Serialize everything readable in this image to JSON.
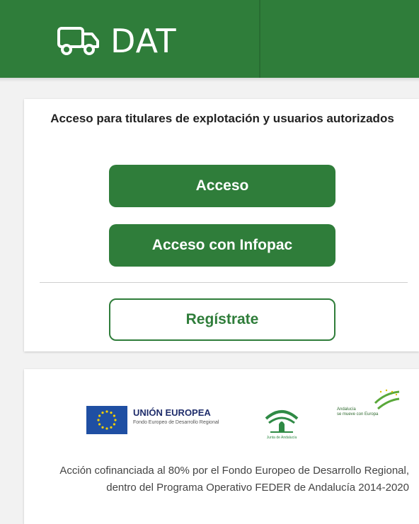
{
  "header": {
    "app_name": "DAT",
    "icon": "truck-icon",
    "color": "#2f7d3a"
  },
  "login": {
    "title": "Acceso para titulares de explotación y usuarios autorizados",
    "access_label": "Acceso",
    "infopac_label": "Acceso con Infopac",
    "register_label": "Regístrate"
  },
  "sponsors": {
    "eu_title": "UNIÓN EUROPEA",
    "eu_subtitle": "Fondo Europeo de Desarrollo Regional",
    "junta_caption": "Junta de Andalucía",
    "andalucia_caption_1": "Andalucía",
    "andalucia_caption_2": "se mueve con Europa",
    "description": "Acción cofinanciada al 80% por el Fondo Europeo de Desarrollo Regional, dentro del Programa Operativo FEDER de Andalucía 2014-2020"
  }
}
